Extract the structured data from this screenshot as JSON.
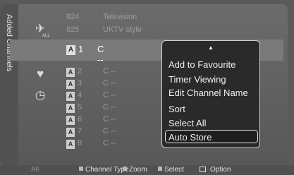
{
  "side_label": "Added Channels",
  "icons": [
    "all-channels-icon",
    "added-channels-icon",
    "favourite-heart-icon",
    "timer-icon"
  ],
  "icon_text": {
    "all": "ALL"
  },
  "top_rows": [
    {
      "num": "824",
      "name": "Television"
    },
    {
      "num": "825",
      "name": "UKTV style"
    }
  ],
  "selected_row": {
    "badge": "A",
    "num": "1",
    "name": "C --"
  },
  "rows": [
    {
      "badge": "A",
      "num": "2",
      "name": "C --"
    },
    {
      "badge": "A",
      "num": "3",
      "name": "C --"
    },
    {
      "badge": "A",
      "num": "4",
      "name": "C --"
    },
    {
      "badge": "A",
      "num": "5",
      "name": "C --"
    },
    {
      "badge": "A",
      "num": "6",
      "name": "C --"
    },
    {
      "badge": "A",
      "num": "7",
      "name": "C --"
    },
    {
      "badge": "A",
      "num": "8",
      "name": "C --"
    }
  ],
  "popup": {
    "up_arrow": "▲",
    "items": [
      {
        "label": "Add to Favourite"
      },
      {
        "label": "Timer Viewing"
      },
      {
        "label": "Edit Channel Name"
      },
      {
        "label": "Sort"
      },
      {
        "label": "Select All"
      },
      {
        "label": "Auto Store",
        "active": true
      }
    ]
  },
  "footer": {
    "all": "All",
    "channel_type": "Channel Type",
    "zoom": "Zoom",
    "select": "Select",
    "option": "Option"
  }
}
